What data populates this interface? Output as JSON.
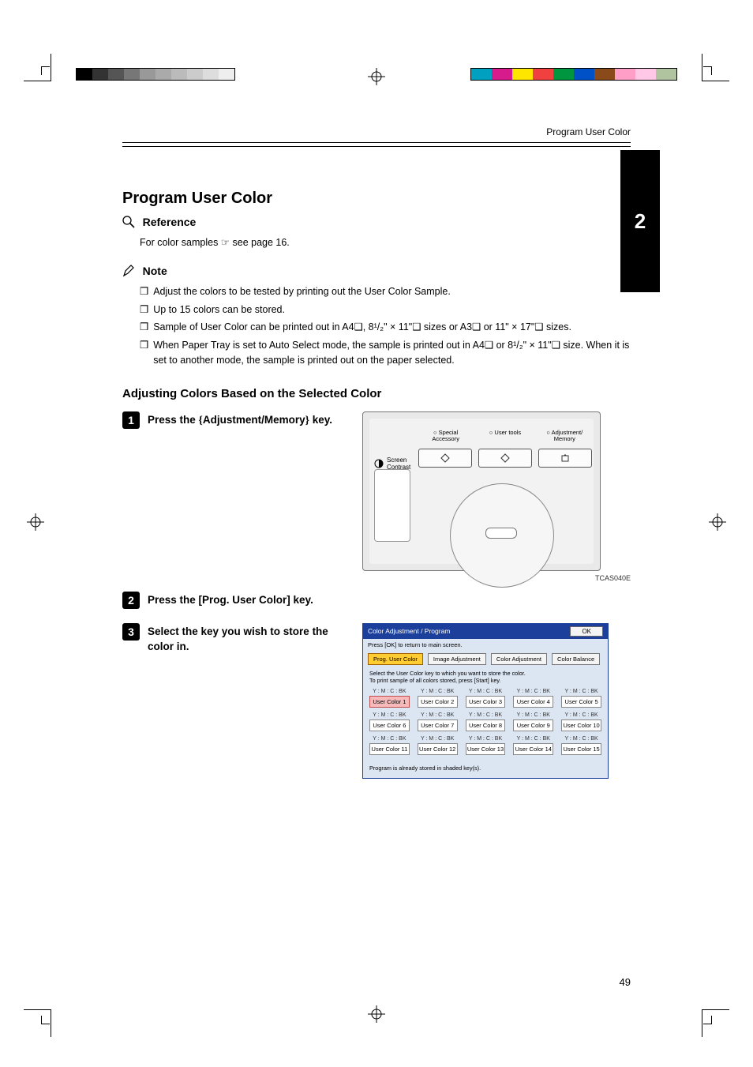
{
  "running_head": "Program User Color",
  "side_tab": "2",
  "section_title": "Program User Color",
  "reference": {
    "title": "Reference",
    "body": "For color samples ☞ see page 16."
  },
  "note": {
    "title": "Note",
    "bullets": [
      "Adjust the colors to be tested by printing out the User Color Sample.",
      "Up to 15 colors can be stored.",
      "Sample of User Color can be printed out in A4❑, 8¹/₂\" × 11\"❑ sizes or A3❑ or 11\" × 17\"❑ sizes.",
      "When Paper Tray is set to Auto Select mode, the sample is printed out in A4❑ or 8¹/₂\" × 11\"❑ size. When it is set to another mode, the sample is printed out on the paper selected."
    ]
  },
  "subhead": "Adjusting Colors Based on the Selected Color",
  "steps": {
    "s1": "Press the {Adjustment/Memory} key.",
    "s2": "Press the [Prog. User Color] key.",
    "s3": "Select the key you wish to store the color in."
  },
  "device": {
    "labels": {
      "special": "Special\nAccessory",
      "usertools": "User tools",
      "adjmem": "Adjustment/\nMemory"
    },
    "contrast": "Screen\nContrast",
    "caption": "TCAS040E"
  },
  "ui": {
    "title": "Color Adjustment / Program",
    "ok": "OK",
    "hint": "Press [OK] to return to main screen.",
    "tabs": {
      "prog": "Prog. User Color",
      "image": "Image Adjustment",
      "coloradj": "Color Adjustment",
      "balance": "Color Balance"
    },
    "instr1": "Select the User Color key to which you want to store the color.",
    "instr2": "To print sample of all colors stored,  press [Start] key.",
    "ymcbk": "Y : M : C : BK",
    "cells": {
      "c1": "User Color 1",
      "c2": "User Color 2",
      "c3": "User Color 3",
      "c4": "User Color 4",
      "c5": "User Color 5",
      "c6": "User Color 6",
      "c7": "User Color 7",
      "c8": "User Color 8",
      "c9": "User Color 9",
      "c10": "User Color 10",
      "c11": "User Color 11",
      "c12": "User Color 12",
      "c13": "User Color 13",
      "c14": "User Color 14",
      "c15": "User Color 15"
    },
    "footer": "Program is already stored in shaded key(s)."
  },
  "page_num": "49",
  "gray_shades": [
    "#000000",
    "#333333",
    "#555555",
    "#777777",
    "#999999",
    "#aaaaaa",
    "#bbbbbb",
    "#cccccc",
    "#dddddd",
    "#eeeeee"
  ],
  "color_swatches": [
    "#00a0c0",
    "#d81b8c",
    "#ffe600",
    "#f04040",
    "#009640",
    "#0050c8",
    "#8a4a1a",
    "#ff9ec7",
    "#ffc8e6",
    "#b0c4a0"
  ]
}
